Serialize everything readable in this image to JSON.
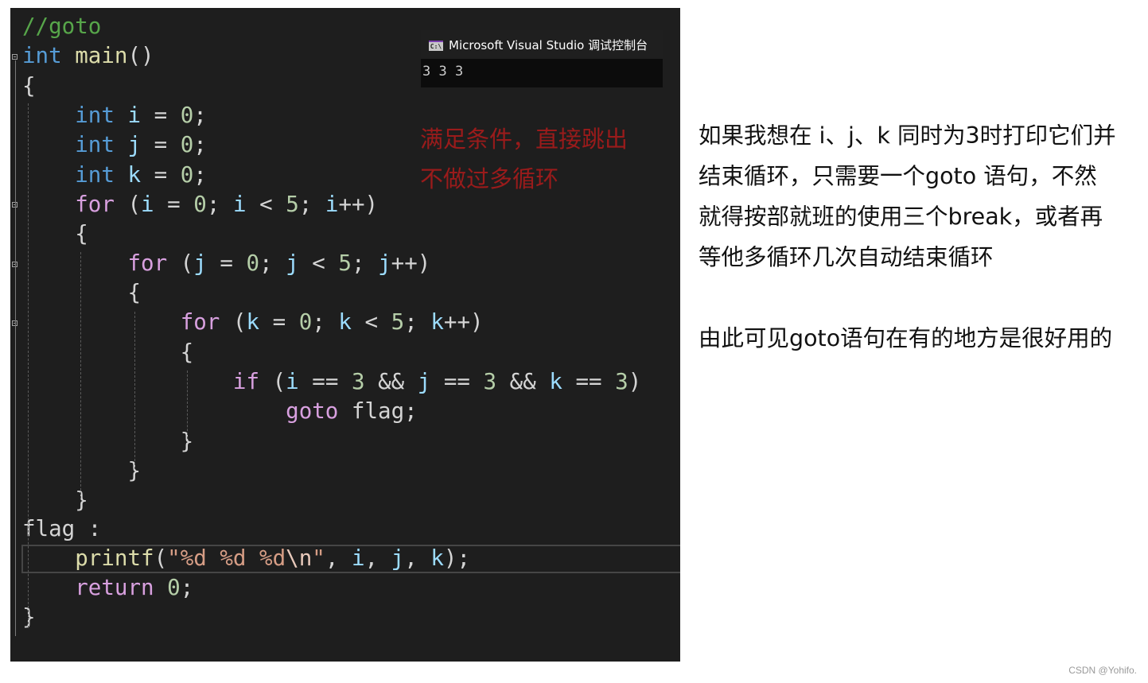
{
  "editor": {
    "code_lines": [
      [
        {
          "t": "//goto",
          "c": "cmt"
        }
      ],
      [
        {
          "t": "int",
          "c": "kw"
        },
        {
          "t": " "
        },
        {
          "t": "main",
          "c": "fn"
        },
        {
          "t": "()"
        }
      ],
      [
        {
          "t": "{"
        }
      ],
      [
        {
          "t": "    "
        },
        {
          "t": "int",
          "c": "kw"
        },
        {
          "t": " "
        },
        {
          "t": "i",
          "c": "var"
        },
        {
          "t": " = "
        },
        {
          "t": "0",
          "c": "num"
        },
        {
          "t": ";"
        }
      ],
      [
        {
          "t": "    "
        },
        {
          "t": "int",
          "c": "kw"
        },
        {
          "t": " "
        },
        {
          "t": "j",
          "c": "var"
        },
        {
          "t": " = "
        },
        {
          "t": "0",
          "c": "num"
        },
        {
          "t": ";"
        }
      ],
      [
        {
          "t": "    "
        },
        {
          "t": "int",
          "c": "kw"
        },
        {
          "t": " "
        },
        {
          "t": "k",
          "c": "var"
        },
        {
          "t": " = "
        },
        {
          "t": "0",
          "c": "num"
        },
        {
          "t": ";"
        }
      ],
      [
        {
          "t": "    "
        },
        {
          "t": "for",
          "c": "ctl"
        },
        {
          "t": " ("
        },
        {
          "t": "i",
          "c": "var"
        },
        {
          "t": " = "
        },
        {
          "t": "0",
          "c": "num"
        },
        {
          "t": "; "
        },
        {
          "t": "i",
          "c": "var"
        },
        {
          "t": " < "
        },
        {
          "t": "5",
          "c": "num"
        },
        {
          "t": "; "
        },
        {
          "t": "i",
          "c": "var"
        },
        {
          "t": "++)"
        }
      ],
      [
        {
          "t": "    {"
        }
      ],
      [
        {
          "t": "        "
        },
        {
          "t": "for",
          "c": "ctl"
        },
        {
          "t": " ("
        },
        {
          "t": "j",
          "c": "var"
        },
        {
          "t": " = "
        },
        {
          "t": "0",
          "c": "num"
        },
        {
          "t": "; "
        },
        {
          "t": "j",
          "c": "var"
        },
        {
          "t": " < "
        },
        {
          "t": "5",
          "c": "num"
        },
        {
          "t": "; "
        },
        {
          "t": "j",
          "c": "var"
        },
        {
          "t": "++)"
        }
      ],
      [
        {
          "t": "        {"
        }
      ],
      [
        {
          "t": "            "
        },
        {
          "t": "for",
          "c": "ctl"
        },
        {
          "t": " ("
        },
        {
          "t": "k",
          "c": "var"
        },
        {
          "t": " = "
        },
        {
          "t": "0",
          "c": "num"
        },
        {
          "t": "; "
        },
        {
          "t": "k",
          "c": "var"
        },
        {
          "t": " < "
        },
        {
          "t": "5",
          "c": "num"
        },
        {
          "t": "; "
        },
        {
          "t": "k",
          "c": "var"
        },
        {
          "t": "++)"
        }
      ],
      [
        {
          "t": "            {"
        }
      ],
      [
        {
          "t": "                "
        },
        {
          "t": "if",
          "c": "ctl"
        },
        {
          "t": " ("
        },
        {
          "t": "i",
          "c": "var"
        },
        {
          "t": " == "
        },
        {
          "t": "3",
          "c": "num"
        },
        {
          "t": " && "
        },
        {
          "t": "j",
          "c": "var"
        },
        {
          "t": " == "
        },
        {
          "t": "3",
          "c": "num"
        },
        {
          "t": " && "
        },
        {
          "t": "k",
          "c": "var"
        },
        {
          "t": " == "
        },
        {
          "t": "3",
          "c": "num"
        },
        {
          "t": ")"
        }
      ],
      [
        {
          "t": "                    "
        },
        {
          "t": "goto",
          "c": "ctl"
        },
        {
          "t": " flag;"
        }
      ],
      [
        {
          "t": "            }"
        }
      ],
      [
        {
          "t": "        }"
        }
      ],
      [
        {
          "t": "    }"
        }
      ],
      [
        {
          "t": "flag :"
        }
      ],
      [
        {
          "t": "    "
        },
        {
          "t": "printf",
          "c": "fn"
        },
        {
          "t": "("
        },
        {
          "t": "\"%d %d %d",
          "c": "str"
        },
        {
          "t": "\\n",
          "c": "esc"
        },
        {
          "t": "\"",
          "c": "str"
        },
        {
          "t": ", "
        },
        {
          "t": "i",
          "c": "var"
        },
        {
          "t": ", "
        },
        {
          "t": "j",
          "c": "var"
        },
        {
          "t": ", "
        },
        {
          "t": "k",
          "c": "var"
        },
        {
          "t": ");"
        }
      ],
      [
        {
          "t": "    "
        },
        {
          "t": "return",
          "c": "ctl"
        },
        {
          "t": " "
        },
        {
          "t": "0",
          "c": "num"
        },
        {
          "t": ";"
        }
      ],
      [
        {
          "t": "}"
        }
      ]
    ],
    "colors": {
      "background": "#1e1e1e",
      "keyword": "#569cd6",
      "control": "#d8a0df",
      "variable": "#9cdcfe",
      "number": "#b5cea8",
      "string": "#d69d85",
      "comment": "#57a64a",
      "function": "#dcdcaa"
    }
  },
  "console": {
    "icon": "console-app-icon",
    "title": "Microsoft Visual Studio 调试控制台",
    "output": "3 3 3"
  },
  "annotation": {
    "lines": [
      "满足条件，直接跳出",
      "不做过多循环"
    ],
    "color": "#9a1b1b"
  },
  "explanation": {
    "paragraph1": [
      "如果我想在 i、j、k 同时为3时打印它们并",
      "结束循环，只需要一个goto 语句，不然",
      "就得按部就班的使用三个break，或者再",
      "等他多循环几次自动结束循环"
    ],
    "paragraph2": "由此可见goto语句在有的地方是很好用的"
  },
  "watermark": "CSDN @Yohifo."
}
